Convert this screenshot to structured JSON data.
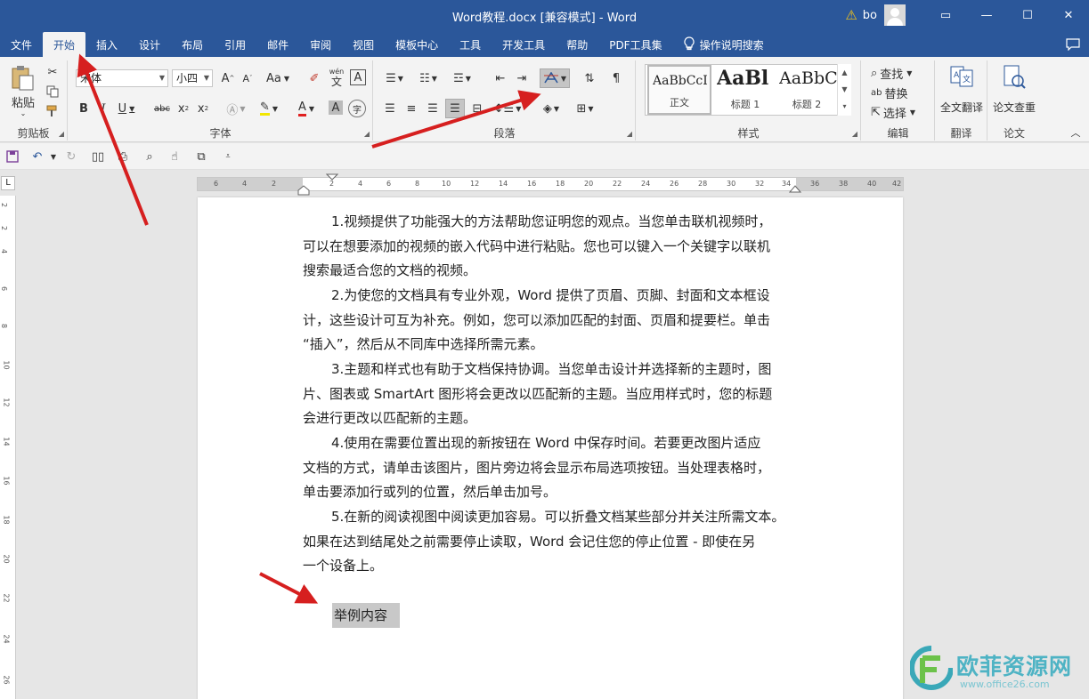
{
  "titlebar": {
    "title": "Word教程.docx [兼容模式]  -  Word",
    "user": "bo",
    "warning_icon": "warning-icon",
    "minimize": "—",
    "maximize": "☐",
    "close": "✕",
    "restore": "▭"
  },
  "tabs": [
    {
      "label": "文件"
    },
    {
      "label": "开始"
    },
    {
      "label": "插入"
    },
    {
      "label": "设计"
    },
    {
      "label": "布局"
    },
    {
      "label": "引用"
    },
    {
      "label": "邮件"
    },
    {
      "label": "审阅"
    },
    {
      "label": "视图"
    },
    {
      "label": "模板中心"
    },
    {
      "label": "工具"
    },
    {
      "label": "开发工具"
    },
    {
      "label": "帮助"
    },
    {
      "label": "PDF工具集"
    },
    {
      "label": "操作说明搜索"
    }
  ],
  "ribbon": {
    "clipboard": {
      "paste": "粘贴",
      "label": "剪贴板"
    },
    "font": {
      "name_value": "宋体",
      "size_value": "小四",
      "aa_label": "Aa",
      "label": "字体",
      "wen": "wén",
      "wen_char": "文",
      "a_char": "A",
      "circle_char": "字"
    },
    "paragraph": {
      "label": "段落"
    },
    "styles": {
      "label": "样式",
      "items": [
        {
          "sample": "AaBbCcI",
          "name": "正文"
        },
        {
          "sample": "AaBl",
          "name": "标题 1"
        },
        {
          "sample": "AaBbC",
          "name": "标题 2"
        }
      ]
    },
    "editing": {
      "find": "查找",
      "replace": "替换",
      "select": "选择",
      "label": "编辑"
    },
    "translate": {
      "btn": "全文翻译",
      "label": "翻译"
    },
    "paper": {
      "btn": "论文查重",
      "label": "论文"
    }
  },
  "ruler": {
    "h_ticks": [
      "6",
      "4",
      "2",
      "2",
      "4",
      "6",
      "8",
      "10",
      "12",
      "14",
      "16",
      "18",
      "20",
      "22",
      "24",
      "26",
      "28",
      "30",
      "32",
      "34",
      "36",
      "38",
      "40",
      "42"
    ],
    "v_ticks": [
      "2",
      "2",
      "4",
      "6",
      "8",
      "10",
      "12",
      "14",
      "16",
      "18",
      "20",
      "22",
      "24",
      "26"
    ],
    "corner": "L"
  },
  "document": {
    "paragraphs": [
      [
        "1.视频提供了功能强大的方法帮助您证明您的观点。当您单击联机视频时，",
        "可以在想要添加的视频的嵌入代码中进行粘贴。您也可以键入一个关键字以联机",
        "搜索最适合您的文档的视频。"
      ],
      [
        "2.为使您的文档具有专业外观，Word 提供了页眉、页脚、封面和文本框设",
        "计，这些设计可互为补充。例如，您可以添加匹配的封面、页眉和提要栏。单击",
        "“插入”，然后从不同库中选择所需元素。"
      ],
      [
        "3.主题和样式也有助于文档保持协调。当您单击设计并选择新的主题时，图",
        "片、图表或 SmartArt 图形将会更改以匹配新的主题。当应用样式时，您的标题",
        "会进行更改以匹配新的主题。"
      ],
      [
        "4.使用在需要位置出现的新按钮在 Word 中保存时间。若要更改图片适应",
        "文档的方式，请单击该图片，图片旁边将会显示布局选项按钮。当处理表格时，",
        "单击要添加行或列的位置，然后单击加号。"
      ],
      [
        "5.在新的阅读视图中阅读更加容易。可以折叠文档某些部分并关注所需文本。",
        "如果在达到结尾处之前需要停止读取，Word 会记住您的停止位置 - 即使在另",
        "一个设备上。"
      ]
    ],
    "selected_text": "举例内容"
  },
  "watermark": {
    "brand": "欧菲资源网",
    "url": "www.office26.com"
  },
  "colors": {
    "accent": "#2b579a",
    "arrow": "#d61f1f"
  }
}
